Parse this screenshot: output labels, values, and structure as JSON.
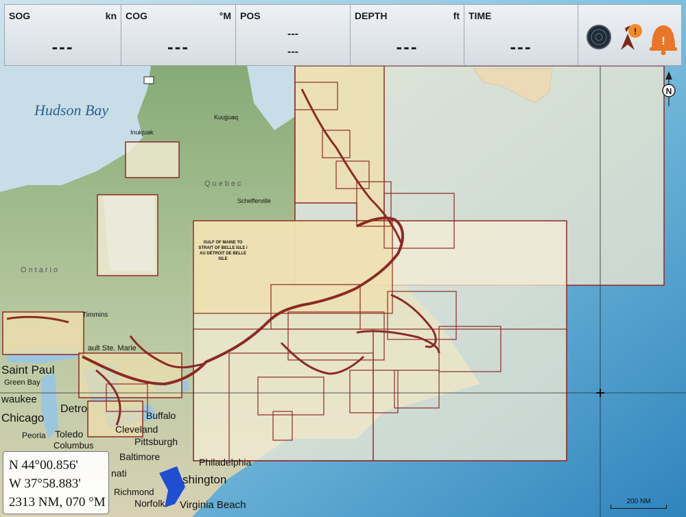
{
  "databar": {
    "fields": [
      {
        "label": "SOG",
        "unit": "kn",
        "value": "---"
      },
      {
        "label": "COG",
        "unit": "°M",
        "value": "---"
      },
      {
        "label": "POS",
        "unit": "",
        "value_line1": "---",
        "value_line2": "---"
      },
      {
        "label": "DEPTH",
        "unit": "ft",
        "value": "---"
      },
      {
        "label": "TIME",
        "unit": "",
        "value": "---"
      }
    ],
    "icons": [
      "radar-icon",
      "ais-warning-icon",
      "alarm-icon"
    ]
  },
  "map": {
    "labels": {
      "hudson_bay": "Hudson Bay",
      "ontario": "Ontario",
      "quebec": "Quebec",
      "saint_paul": "Saint Paul",
      "green_bay": "Green Bay",
      "milwaukee": "waukee",
      "chicago": "Chicago",
      "detroit": "Detro",
      "toledo": "Toledo",
      "peoria": "Peoria",
      "columbus": "Columbus",
      "cleveland": "Cleveland",
      "buffalo": "Buffalo",
      "pittsburgh": "Pittsburgh",
      "baltimore": "Baltimore",
      "philadelphia": "Philadelphia",
      "washington": "shington",
      "richmond": "Richmond",
      "norfolk": "Norfolk",
      "virginia_beach": "Virginia Beach",
      "cincinnati": "nati",
      "sault": "ault Ste. Marie",
      "timmins": "Timmins",
      "inukjuak": "Inukjuak",
      "kuujjuaq": "Kuujjuaq",
      "schefferville": "Schefferville",
      "chart_title": "GULF OF MAINE TO STRAIT OF BELLE ISLE / AU DÉTROIT DE BELLE ISLE"
    },
    "north_indicator": "N",
    "scale_label": "200 NM"
  },
  "cursor_readout": {
    "lat": "N  44°00.856'",
    "lon": "W  37°58.883'",
    "range_bearing": "2313 NM, 070 °M"
  },
  "colors": {
    "chart_outline": "#8b2a24",
    "chart_fill": "#f1e3b2",
    "land": "#8fae7e",
    "water": "#7fb4d4",
    "deep_water": "#3a8ac0",
    "databar": "#e4e8ec"
  }
}
